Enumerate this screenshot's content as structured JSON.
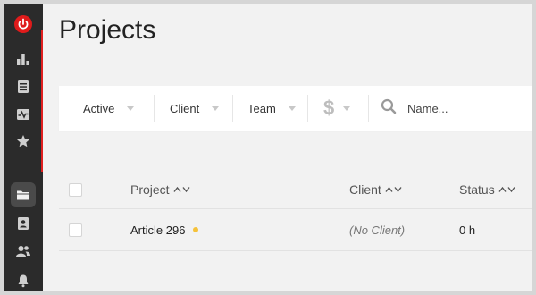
{
  "page": {
    "title": "Projects"
  },
  "sidebar": {
    "items": [
      {
        "name": "power",
        "icon": "power-icon"
      },
      {
        "name": "reports",
        "icon": "bar-chart-icon"
      },
      {
        "name": "timesheet",
        "icon": "list-icon"
      },
      {
        "name": "insights",
        "icon": "activity-icon"
      },
      {
        "name": "favorites",
        "icon": "star-icon"
      },
      {
        "name": "projects",
        "icon": "folder-icon",
        "active": true
      },
      {
        "name": "clients",
        "icon": "contact-card-icon"
      },
      {
        "name": "team",
        "icon": "users-icon"
      },
      {
        "name": "notifications",
        "icon": "bell-icon"
      }
    ],
    "accent": "#e02020"
  },
  "filters": {
    "active": "Active",
    "client": "Client",
    "team": "Team",
    "billable": "$",
    "search_placeholder": "Name..."
  },
  "table": {
    "columns": [
      "Project",
      "Client",
      "Status"
    ],
    "rows": [
      {
        "project": "Article 296",
        "client": "(No Client)",
        "status": "0 h",
        "color": "#f5c23a"
      }
    ]
  }
}
